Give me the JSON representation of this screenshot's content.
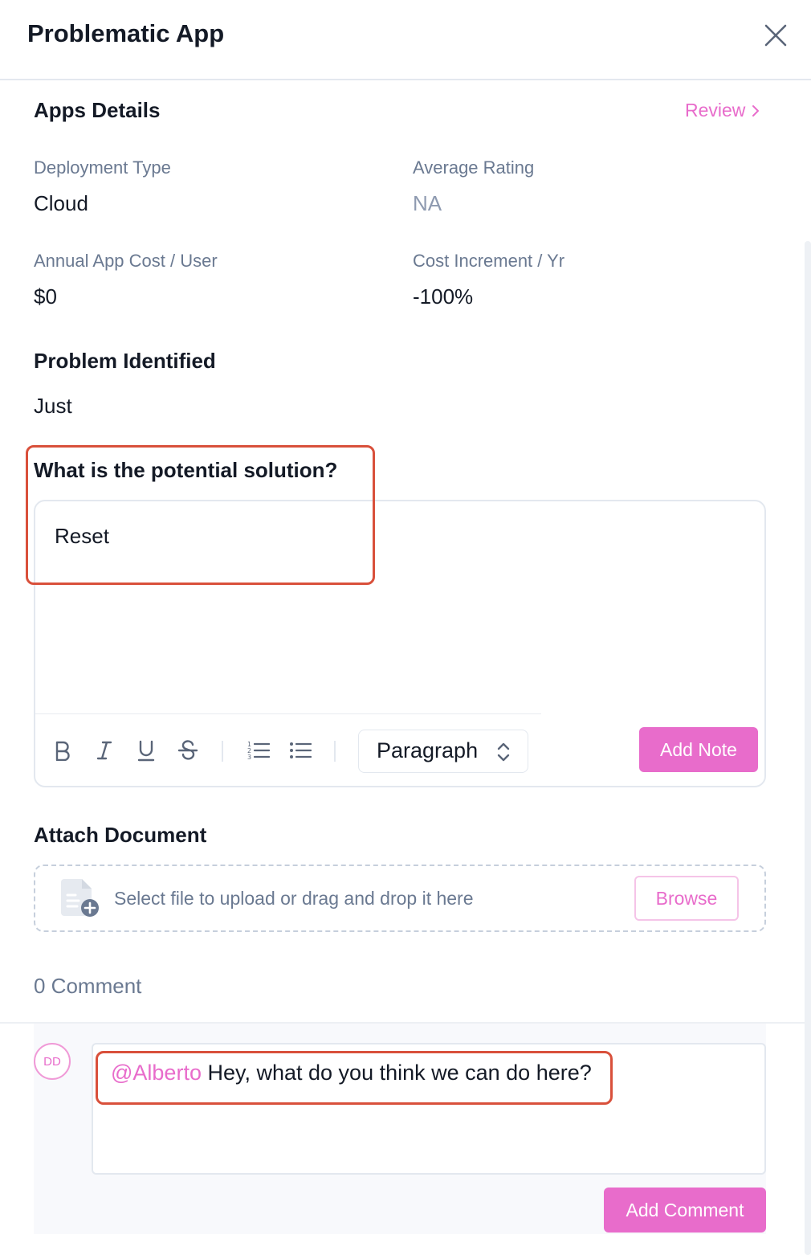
{
  "header": {
    "title": "Problematic App"
  },
  "apps_details": {
    "title": "Apps Details",
    "review_label": "Review",
    "fields": {
      "deployment_type": {
        "label": "Deployment Type",
        "value": "Cloud"
      },
      "average_rating": {
        "label": "Average Rating",
        "value": "NA"
      },
      "annual_cost": {
        "label": "Annual App Cost / User",
        "value": "$0"
      },
      "cost_increment": {
        "label": "Cost Increment / Yr",
        "value": "-100%"
      }
    }
  },
  "problem": {
    "title": "Problem Identified",
    "text": "Just"
  },
  "solution": {
    "title": "What is the potential solution?",
    "text": "Reset",
    "paragraph_select": "Paragraph",
    "add_note_label": "Add Note"
  },
  "attach": {
    "title": "Attach Document",
    "drop_message": "Select file to upload or drag and drop it here",
    "browse_label": "Browse"
  },
  "comments": {
    "count_label": "0 Comment",
    "avatar_initials": "DD",
    "draft_mention": "@Alberto",
    "draft_text": " Hey, what do you think we can do here?",
    "add_comment_label": "Add Comment"
  },
  "colors": {
    "accent": "#e86ccb",
    "highlight": "#d9503b",
    "label": "#6a7991"
  }
}
